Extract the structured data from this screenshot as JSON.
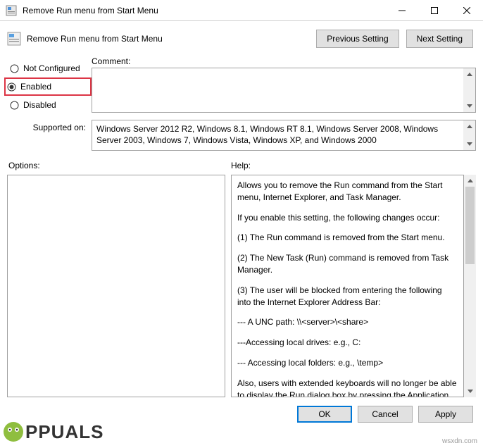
{
  "window": {
    "title": "Remove Run menu from Start Menu",
    "subtitle": "Remove Run menu from Start Menu"
  },
  "nav": {
    "previous": "Previous Setting",
    "next": "Next Setting"
  },
  "radios": {
    "not_configured": "Not Configured",
    "enabled": "Enabled",
    "disabled": "Disabled",
    "selected": "enabled"
  },
  "comment": {
    "label": "Comment:",
    "value": ""
  },
  "supported": {
    "label": "Supported on:",
    "text": "Windows Server 2012 R2, Windows 8.1, Windows RT 8.1, Windows Server 2008, Windows Server 2003, Windows 7, Windows Vista, Windows XP, and Windows 2000"
  },
  "sections": {
    "options": "Options:",
    "help": "Help:"
  },
  "help": {
    "p1": "Allows you to remove the Run command from the Start menu, Internet Explorer, and Task Manager.",
    "p2": "If you enable this setting, the following changes occur:",
    "p3": "(1) The Run command is removed from the Start menu.",
    "p4": "(2) The New Task (Run) command is removed from Task Manager.",
    "p5": "(3) The user will be blocked from entering the following into the Internet Explorer Address Bar:",
    "p6": "--- A UNC path: \\\\<server>\\<share>",
    "p7": "---Accessing local drives:  e.g., C:",
    "p8": "--- Accessing local folders: e.g., \\temp>",
    "p9": "Also, users with extended keyboards will no longer be able to display the Run dialog box by pressing the Application key (the"
  },
  "footer": {
    "ok": "OK",
    "cancel": "Cancel",
    "apply": "Apply"
  },
  "watermark": "wsxdn.com",
  "brand": "PPUALS"
}
